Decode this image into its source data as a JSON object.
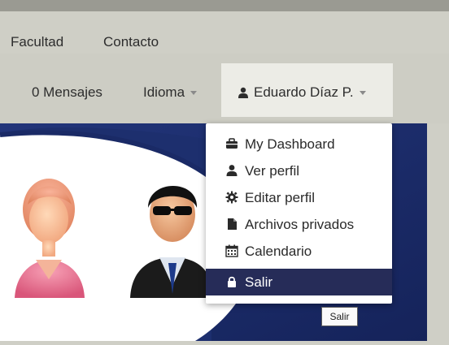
{
  "nav_primary": {
    "items": [
      "Facultad",
      "Contacto"
    ]
  },
  "nav_secondary": {
    "messages": "0 Mensajes",
    "language": "Idioma",
    "user": "Eduardo Díaz P."
  },
  "user_menu": {
    "items": [
      {
        "label": "My Dashboard",
        "icon": "briefcase-icon"
      },
      {
        "label": "Ver perfil",
        "icon": "user-icon"
      },
      {
        "label": "Editar perfil",
        "icon": "cog-icon"
      },
      {
        "label": "Archivos privados",
        "icon": "file-icon"
      },
      {
        "label": "Calendario",
        "icon": "calendar-icon"
      },
      {
        "label": "Salir",
        "icon": "lock-icon"
      }
    ],
    "active_index": 5
  },
  "tooltip": "Salir",
  "colors": {
    "active": "#262c58",
    "banner_blue": "#1d2f6e"
  }
}
